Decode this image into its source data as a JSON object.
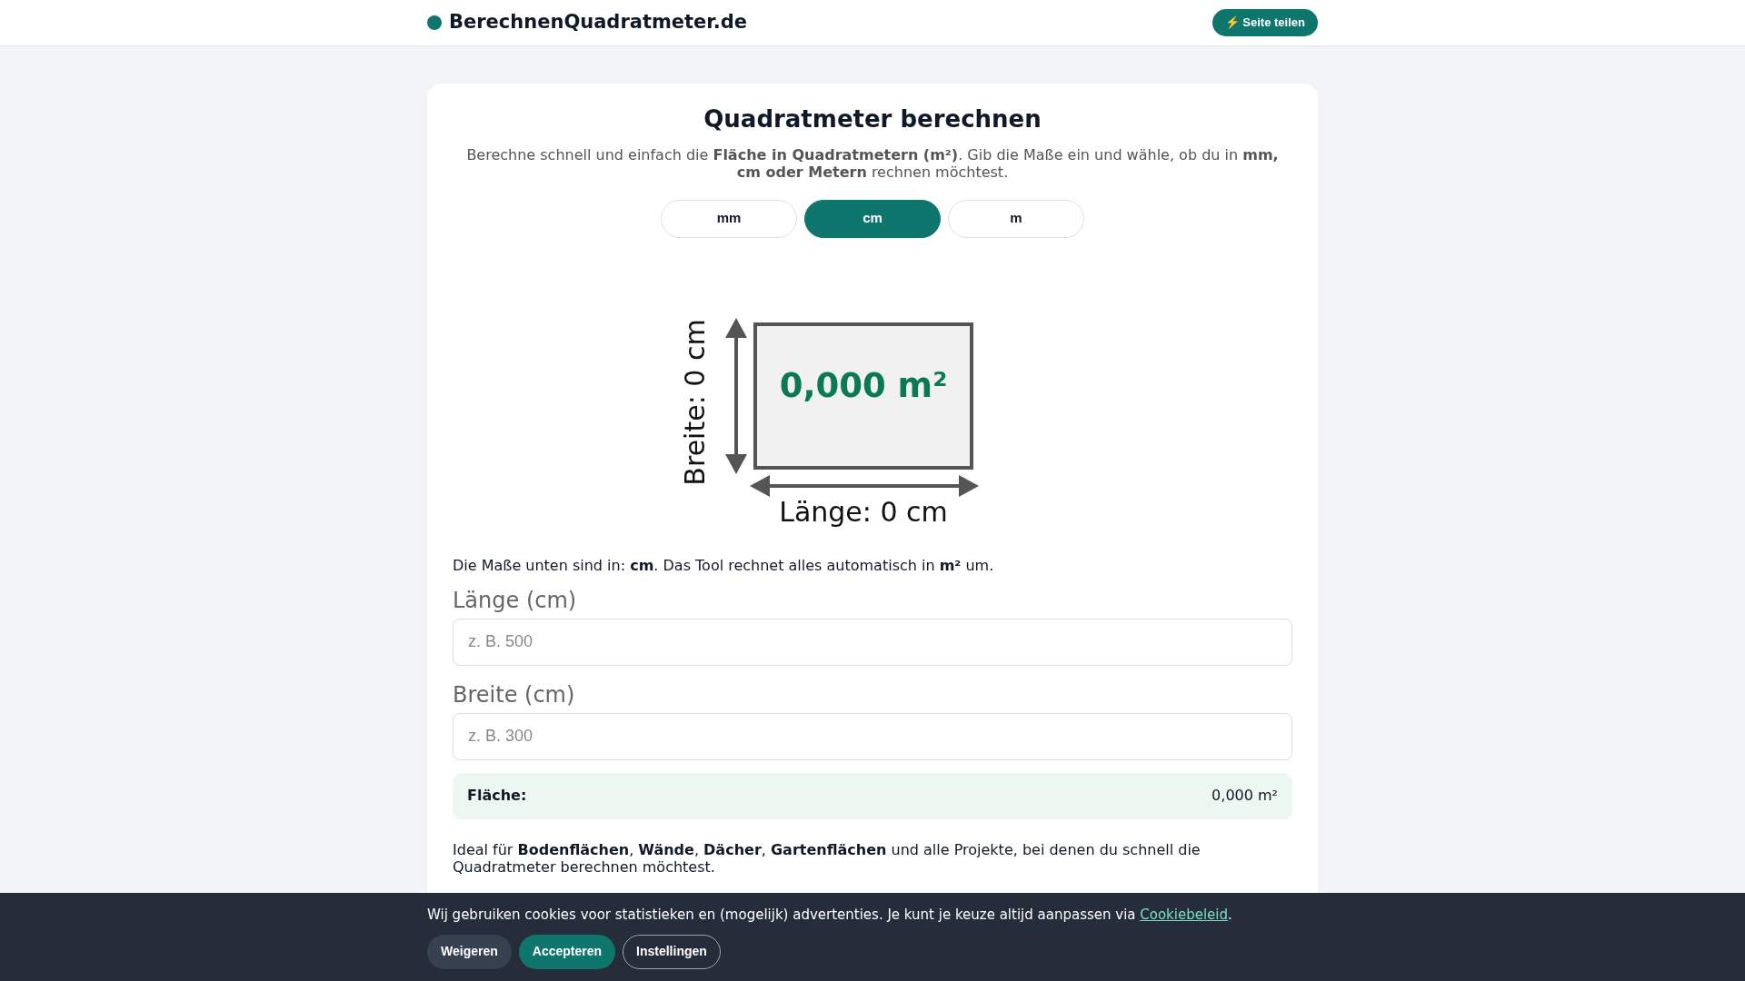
{
  "header": {
    "logo_text": "BerechnenQuadratmeter.de",
    "share_button": {
      "icon": "⚡",
      "label": "Seite teilen"
    }
  },
  "card": {
    "title": "Quadratmeter berechnen",
    "intro": "Berechne schnell und einfach die **Fläche in Quadratmetern (m²)**. Gib die Maße ein und wähle, ob du in **mm, cm oder Metern** rechnen möchtest.",
    "units": [
      {
        "label": "mm",
        "selected": false
      },
      {
        "label": "cm",
        "selected": true
      },
      {
        "label": "m",
        "selected": false
      }
    ],
    "diagram": {
      "area": "0,000 m²",
      "length_label": "Länge: 0 cm",
      "width_label": "Breite: 0 cm"
    },
    "units_note": "Die Maße unten sind in: **cm**. Das Tool rechnet alles automatisch in **m²** um.",
    "fields": [
      {
        "label": "Länge (cm)",
        "placeholder": "z. B. 500"
      },
      {
        "label": "Breite (cm)",
        "placeholder": "z. B. 300"
      }
    ],
    "result": {
      "label": "Fläche:",
      "value": "0,000 m²"
    },
    "ideal_text": "Ideal für **Bodenflächen**, **Wände**, **Dächer**, **Gartenflächen** und alle Projekte, bei denen du schnell die Quadratmeter berechnen möchtest."
  },
  "cookie_banner": {
    "text": "Wij gebruiken cookies voor statistieken en (mogelijk) advertenties. Je kunt je keuze altijd aanpassen via",
    "link": "Cookiebeleid",
    "text_after": ".",
    "buttons": [
      {
        "label": "Weigeren",
        "kind": "secondary"
      },
      {
        "label": "Accepteren",
        "kind": "primary"
      },
      {
        "label": "Instellingen",
        "kind": "outline"
      }
    ]
  }
}
